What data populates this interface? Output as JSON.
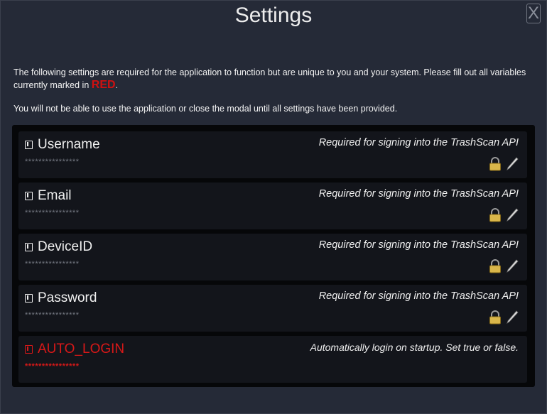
{
  "modal": {
    "title": "Settings",
    "close_label": "X",
    "intro_text": "The following settings are required for the application to function but are unique to you and your system. Please fill out all variables currently marked in ",
    "intro_red": "RED",
    "intro_end": ".",
    "warning_text": "You will not be able to use the application or close the modal until all settings have been provided."
  },
  "settings": [
    {
      "key": "Username",
      "value": "****************",
      "description": "Required for signing into the TrashScan API"
    },
    {
      "key": "Email",
      "value": "****************",
      "description": "Required for signing into the TrashScan API"
    },
    {
      "key": "DeviceID",
      "value": "****************",
      "description": "Required for signing into the TrashScan API"
    },
    {
      "key": "Password",
      "value": "****************",
      "description": "Required for signing into the TrashScan API"
    },
    {
      "key": "AUTO_LOGIN",
      "value": "****************",
      "description": "Automatically login on startup. Set true or false."
    }
  ],
  "icons": {
    "key": "key-icon",
    "lock": "lock-icon",
    "edit": "pen-icon",
    "close": "close-icon"
  },
  "colors": {
    "required": "#d81818",
    "background": "#252a37",
    "row": "#13151b"
  }
}
